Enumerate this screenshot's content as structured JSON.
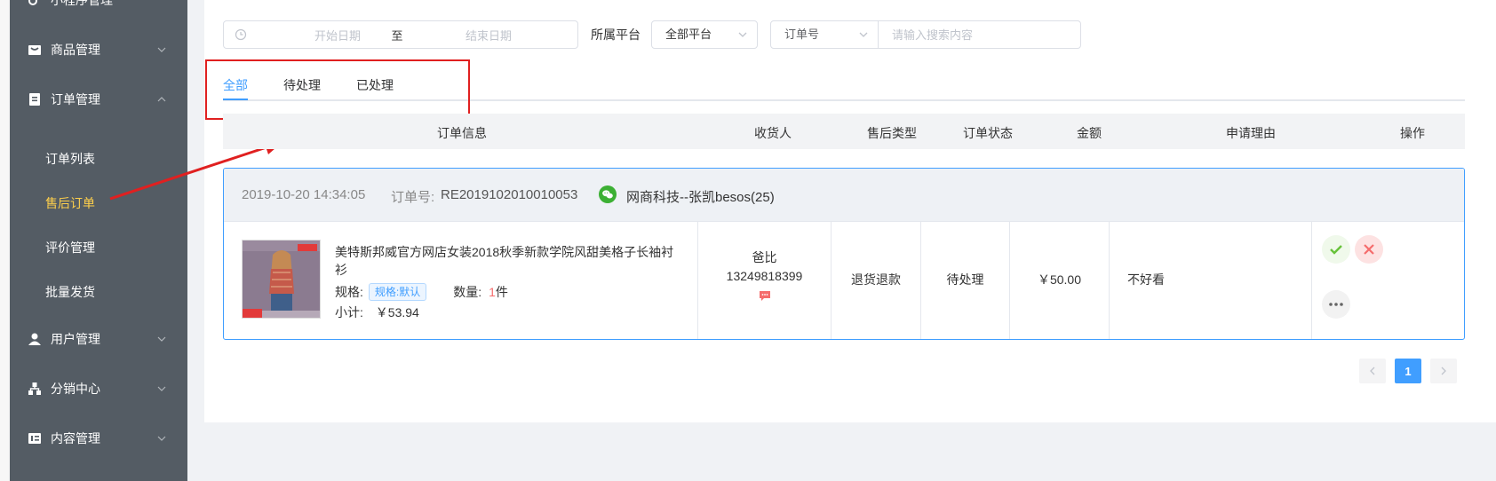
{
  "sidebar": {
    "top_partial": "小程序管理",
    "groups": [
      {
        "label": "商品管理",
        "icon": "goods-icon"
      },
      {
        "label": "订单管理",
        "icon": "order-icon"
      },
      {
        "label": "用户管理",
        "icon": "user-icon"
      },
      {
        "label": "分销中心",
        "icon": "distribution-icon"
      },
      {
        "label": "内容管理",
        "icon": "content-icon"
      }
    ],
    "order_sub": [
      "订单列表",
      "售后订单",
      "评价管理",
      "批量发货"
    ],
    "active_sub": "售后订单",
    "active_color": "#ffd04b",
    "bg_color": "#545c64"
  },
  "filters": {
    "start_placeholder": "开始日期",
    "to_label": "至",
    "end_placeholder": "结束日期",
    "platform_label": "所属平台",
    "platform_value": "全部平台",
    "search_type": "订单号",
    "search_placeholder": "请输入搜索内容"
  },
  "tabs": [
    "全部",
    "待处理",
    "已处理"
  ],
  "active_tab": "全部",
  "table_headers": [
    "订单信息",
    "收货人",
    "售后类型",
    "订单状态",
    "金额",
    "申请理由",
    "操作"
  ],
  "order": {
    "date": "2019-10-20 14:34:05",
    "order_no_label": "订单号:",
    "order_no": "RE2019102010010053",
    "shop": "网商科技--张凯besos(25)",
    "product_title": "美特斯邦威官方网店女装2018秋季新款学院风甜美格子长袖衬衫",
    "spec_label": "规格:",
    "spec_value": "规格:默认",
    "qty_label": "数量:",
    "qty_value": "1",
    "qty_unit": "件",
    "subtotal_label": "小计:",
    "subtotal": "￥53.94",
    "receiver_name": "爸比",
    "receiver_phone": "13249818399",
    "aftersale_type": "退货退款",
    "status": "待处理",
    "amount": "￥50.00",
    "reason": "不好看"
  },
  "pager": {
    "current": "1"
  },
  "colors": {
    "accent": "#409eff",
    "annotation": "#e02020",
    "approve": "#67c23a",
    "reject": "#f56c6c"
  }
}
